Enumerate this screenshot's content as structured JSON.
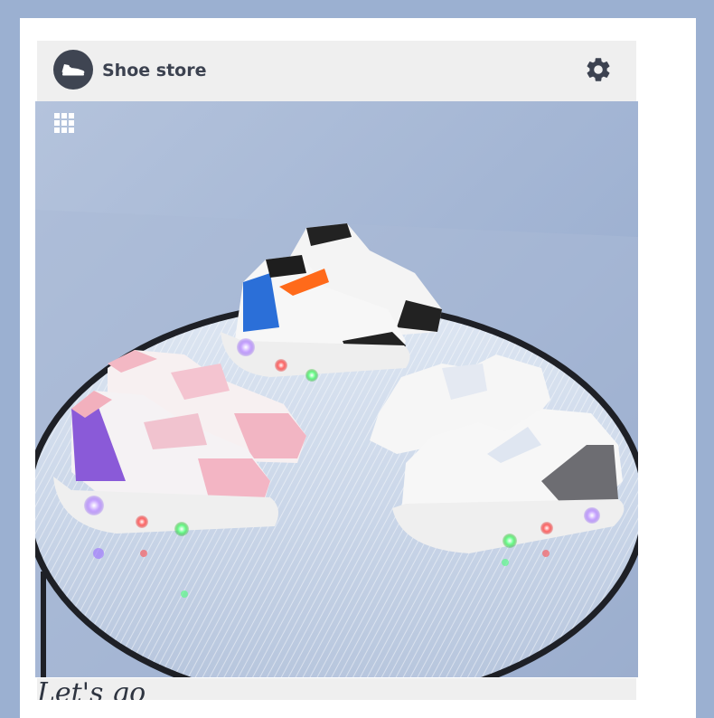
{
  "app": {
    "title": "Shoe store",
    "logo_icon": "sneaker-icon",
    "settings_icon": "gear-icon",
    "menu_icon": "grid-icon"
  },
  "hero": {
    "image_subject": "kids light-up sneakers on glass table"
  },
  "footer": {
    "partial_text": "Let's go"
  },
  "colors": {
    "background": "#9bb0d1",
    "header_bg": "#efefef",
    "title_color": "#3c4250",
    "logo_bg": "#3f4552"
  }
}
